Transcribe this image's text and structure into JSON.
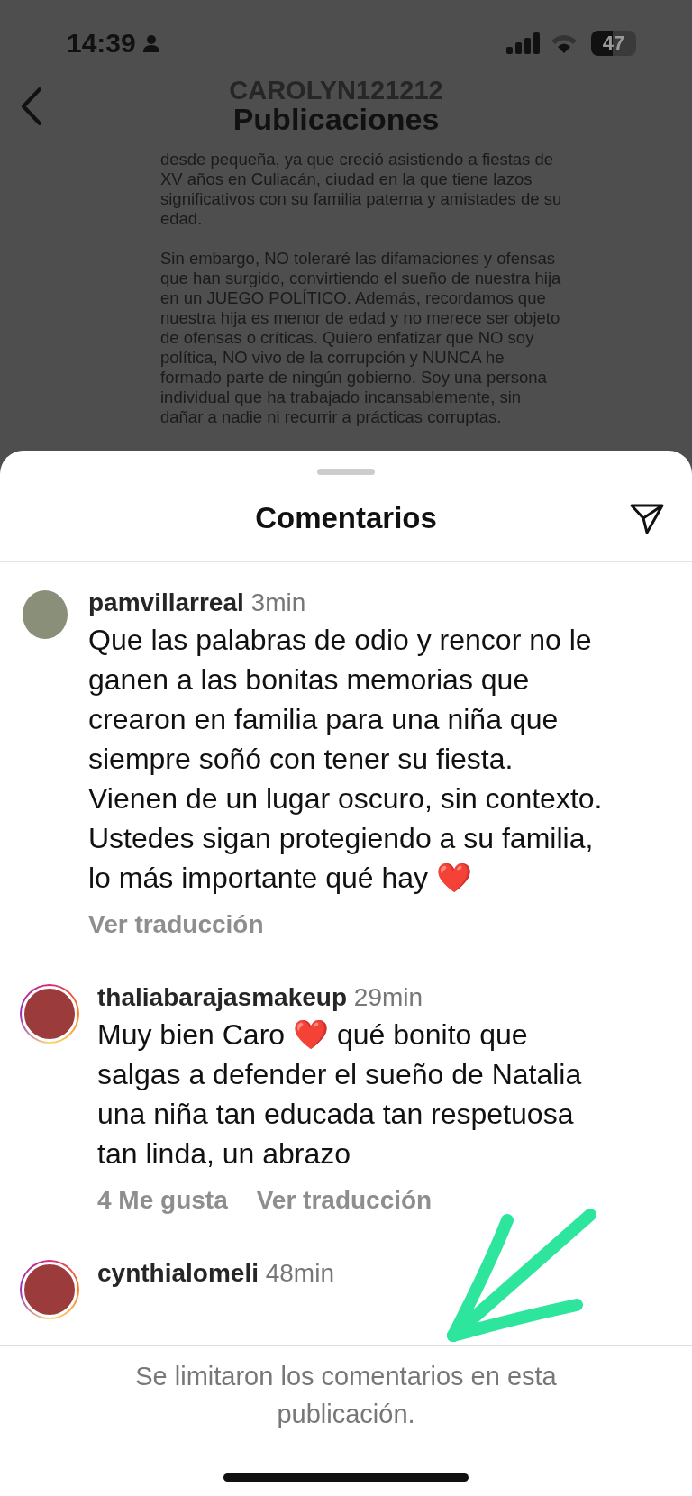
{
  "status_bar": {
    "time": "14:39",
    "battery": "47"
  },
  "header": {
    "account": "CAROLYN121212",
    "title": "Publicaciones"
  },
  "post_text": [
    "desde pequeña, ya que creció asistiendo a fiestas de XV años en Culiacán, ciudad en la que tiene lazos significativos con su familia paterna y amistades de su edad.",
    "Sin embargo, NO toleraré las difamaciones y ofensas que han surgido, convirtiendo el sueño de nuestra hija en un JUEGO POLÍTICO. Además, recordamos que nuestra hija es menor de edad y no merece ser objeto de ofensas o críticas. Quiero enfatizar que NO soy política, NO vivo de la corrupción y NUNCA he formado parte de ningún gobierno. Soy una persona individual que ha trabajado incansablemente, sin dañar a nadie ni recurrir a prácticas corruptas."
  ],
  "comments_sheet": {
    "title": "Comentarios",
    "comments": [
      {
        "username": "pamvillarreal",
        "time": "3min",
        "story_ring": false,
        "text": "Que las palabras de odio y rencor no le ganen a las bonitas memorias que crearon en familia para una niña que siempre soñó con tener su fiesta. Vienen de un lugar oscuro, sin contexto. Ustedes sigan protegiendo a su familia, lo más importante qué hay ❤️",
        "translate": "Ver traducción"
      },
      {
        "username": "thaliabarajasmakeup",
        "time": "29min",
        "story_ring": true,
        "text": "Muy bien Caro ❤️ qué bonito que salgas a defender el sueño de Natalia una niña tan educada tan respetuosa tan linda, un abrazo",
        "likes": "4 Me gusta",
        "translate": "Ver traducción"
      },
      {
        "username": "cynthialomeli",
        "time": "48min",
        "story_ring": true
      }
    ],
    "footer_notice": "Se limitaron los comentarios en esta publicación."
  }
}
